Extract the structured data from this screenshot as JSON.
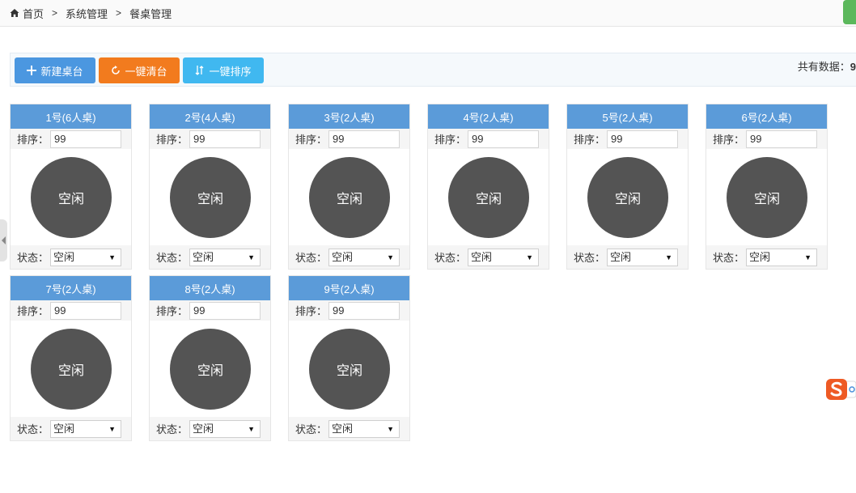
{
  "breadcrumb": {
    "items": [
      "首页",
      "系统管理",
      "餐桌管理"
    ],
    "separator": ">"
  },
  "toolbar": {
    "new_label": "新建桌台",
    "clear_label": "一键清台",
    "sort_label": "一键排序",
    "count_label": "共有数据：",
    "count_value": "9"
  },
  "tables": [
    {
      "title": "1号(6人桌)",
      "sort_label": "排序：",
      "sort_value": "99",
      "state": "空闲",
      "status_label": "状态：",
      "status_value": "空闲"
    },
    {
      "title": "2号(4人桌)",
      "sort_label": "排序：",
      "sort_value": "99",
      "state": "空闲",
      "status_label": "状态：",
      "status_value": "空闲"
    },
    {
      "title": "3号(2人桌)",
      "sort_label": "排序：",
      "sort_value": "99",
      "state": "空闲",
      "status_label": "状态：",
      "status_value": "空闲"
    },
    {
      "title": "4号(2人桌)",
      "sort_label": "排序：",
      "sort_value": "99",
      "state": "空闲",
      "status_label": "状态：",
      "status_value": "空闲"
    },
    {
      "title": "5号(2人桌)",
      "sort_label": "排序：",
      "sort_value": "99",
      "state": "空闲",
      "status_label": "状态：",
      "status_value": "空闲"
    },
    {
      "title": "6号(2人桌)",
      "sort_label": "排序：",
      "sort_value": "99",
      "state": "空闲",
      "status_label": "状态：",
      "status_value": "空闲"
    },
    {
      "title": "7号(2人桌)",
      "sort_label": "排序：",
      "sort_value": "99",
      "state": "空闲",
      "status_label": "状态：",
      "status_value": "空闲"
    },
    {
      "title": "8号(2人桌)",
      "sort_label": "排序：",
      "sort_value": "99",
      "state": "空闲",
      "status_label": "状态：",
      "status_value": "空闲"
    },
    {
      "title": "9号(2人桌)",
      "sort_label": "排序：",
      "sort_value": "99",
      "state": "空闲",
      "status_label": "状态：",
      "status_value": "空闲"
    }
  ],
  "icons": {
    "home": "home-icon",
    "add": "plus-icon",
    "clear": "refresh-icon",
    "sort": "sort-icon",
    "dropdown": "dropdown-arrow-icon",
    "sogou": "sogou-ime-icon"
  },
  "colors": {
    "card_header": "#5b9bd9",
    "table_circle": "#545454",
    "btn_new": "#4b97e0",
    "btn_clear": "#f27b1e",
    "btn_sort": "#40b8f0"
  }
}
